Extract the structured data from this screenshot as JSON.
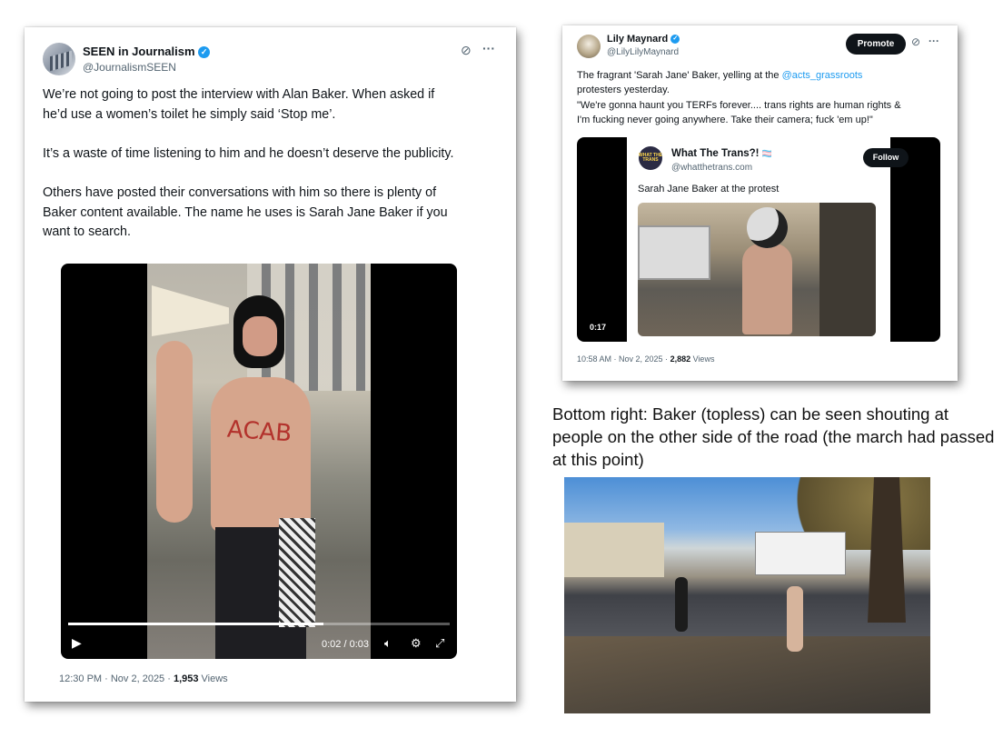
{
  "left_tweet": {
    "author_name": "SEEN in Journalism",
    "author_handle": "@JournalismSEEN",
    "body_lines": [
      "We’re not going to post the interview with Alan Baker.  When asked if",
      "he’d use a women’s toilet he simply said ‘Stop me’.",
      "",
      "It’s a waste of time listening to him and he doesn’t deserve the publicity.",
      "",
      "Others have posted their conversations with him so there is plenty of",
      "Baker content available. The name he uses is Sarah Jane Baker if you",
      "want to search."
    ],
    "video": {
      "time": "0:02 / 0:03",
      "progress": 0.67,
      "overlay_text": "ACAB"
    },
    "timestamp": "12:30 PM · Nov 2, 2025 · ",
    "views_count": "1,953",
    "views_label": " Views"
  },
  "right_tweet": {
    "author_name": "Lily Maynard",
    "author_handle": "@LilyLilyMaynard",
    "promote_label": "Promote",
    "body_line1_a": "The fragrant 'Sarah Jane' Baker, yelling at the ",
    "body_line1_mention": "@acts_grassroots",
    "body_line2": "protesters yesterday.",
    "body_line3": "\"We're gonna haunt you TERFs forever.... trans rights are human rights &",
    "body_line4": "I'm fucking never going anywhere. Take their camera; fuck 'em up!\"",
    "quoted": {
      "avatar_text": "WHAT THE TRANS",
      "author_name": "What The Trans?!",
      "flag_emoji": "🏳️‍⚧️",
      "author_handle": "@whatthetrans.com",
      "follow_label": "Follow",
      "text": "Sarah Jane Baker at the protest",
      "duration": "0:17"
    },
    "timestamp": "10:58 AM · Nov 2, 2025 · ",
    "views_count": "2,882",
    "views_label": " Views"
  },
  "caption": "Bottom right: Baker (topless) can be seen shouting at people on the other side of the road (the march had passed at this point)",
  "colors": {
    "accent": "#1d9bf0",
    "text": "#0f1419",
    "muted": "#536471"
  },
  "icons": [
    "verified-badge-icon",
    "grok-icon",
    "more-icon",
    "play-icon",
    "volume-icon",
    "settings-icon",
    "fullscreen-icon"
  ]
}
